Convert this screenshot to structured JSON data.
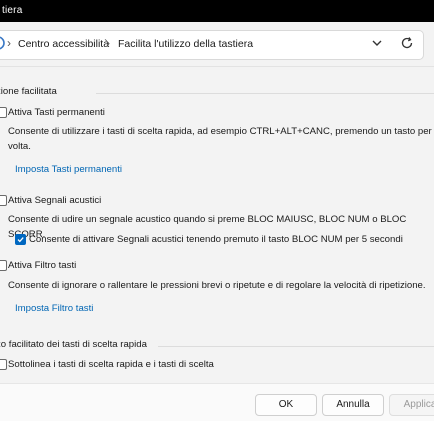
{
  "window": {
    "title": "tiera"
  },
  "address": {
    "crumbs": [
      "Centro accessibilità",
      "Facilita l'utilizzo della tastiera"
    ],
    "separator": "›"
  },
  "sections": {
    "facilitazione": {
      "heading": "zione facilitata"
    },
    "scelta_rapida": {
      "heading": "zo facilitato dei tasti di scelta rapida"
    }
  },
  "options": {
    "tasti_permanenti": {
      "label": "Attiva Tasti permanenti",
      "checked": false,
      "desc_line1": "Consente di utilizzare i tasti di scelta rapida, ad esempio CTRL+ALT+CANC, premendo un tasto per",
      "desc_line2": "volta.",
      "link": "Imposta Tasti permanenti"
    },
    "segnali_acustici": {
      "label": "Attiva Segnali acustici",
      "checked": false,
      "desc": "Consente di udire un segnale acustico quando si preme BLOC MAIUSC, BLOC NUM o BLOC SCORR.",
      "sub_label": "Consente di attivare Segnali acustici tenendo premuto il tasto BLOC NUM per 5 secondi",
      "sub_checked": true
    },
    "filtro_tasti": {
      "label": "Attiva Filtro tasti",
      "checked": false,
      "desc": "Consente di ignorare o rallentare le pressioni brevi o ripetute e di regolare la velocità di ripetizione.",
      "link": "Imposta Filtro tasti"
    },
    "sottolinea": {
      "label": "Sottolinea i tasti di scelta rapida e i tasti di scelta",
      "checked": false
    }
  },
  "buttons": {
    "ok": "OK",
    "cancel": "Annulla",
    "apply": "Applica"
  },
  "icons": {
    "expand": "chevron-down-icon",
    "refresh": "refresh-icon",
    "check": "checkmark-icon"
  },
  "colors": {
    "accent": "#0067c0",
    "link": "#0066b4",
    "titlebar": "#000000"
  }
}
